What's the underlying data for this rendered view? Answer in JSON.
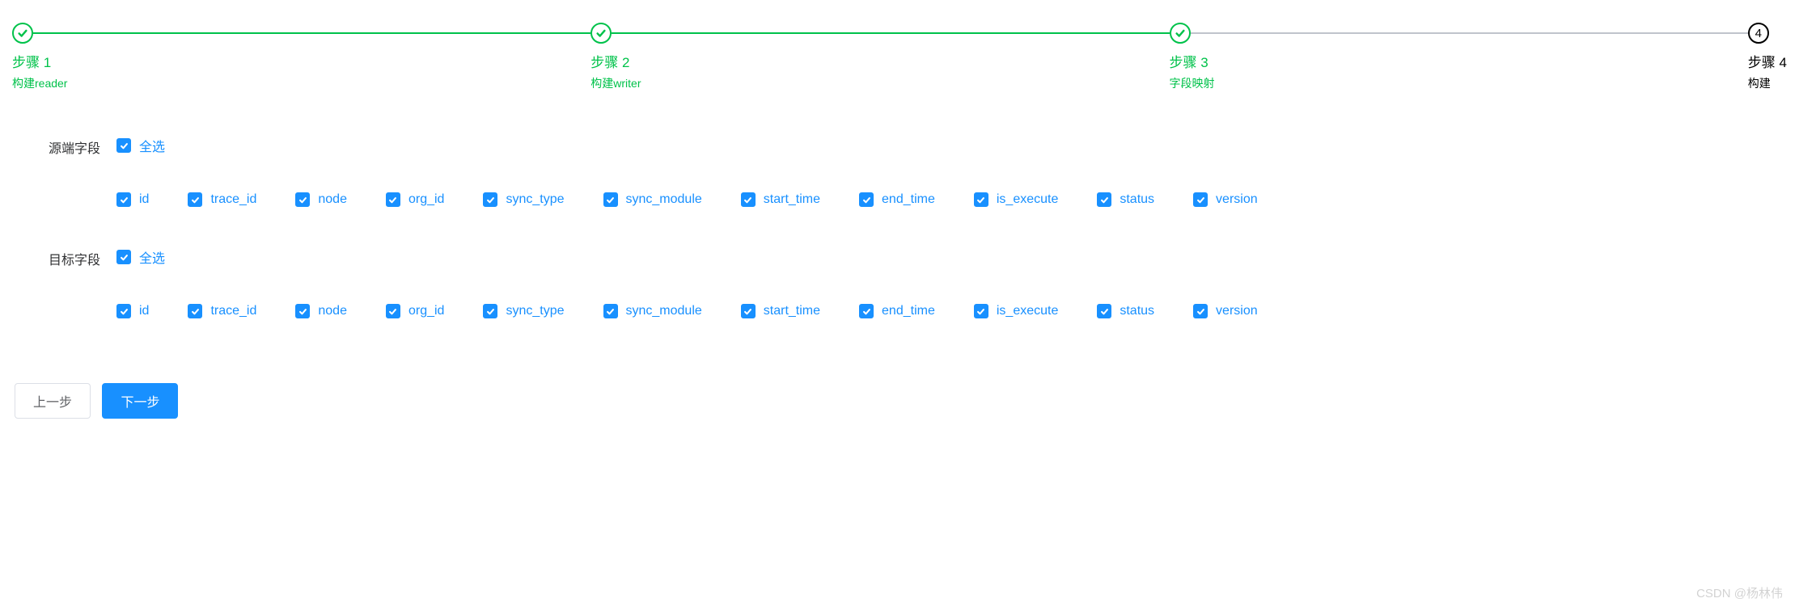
{
  "steps": [
    {
      "title": "步骤 1",
      "desc": "构建reader",
      "status": "done"
    },
    {
      "title": "步骤 2",
      "desc": "构建writer",
      "status": "done"
    },
    {
      "title": "步骤 3",
      "desc": "字段映射",
      "status": "done"
    },
    {
      "title": "步骤 4",
      "desc": "构建",
      "status": "wait",
      "number": "4"
    }
  ],
  "source": {
    "label": "源端字段",
    "selectAll": "全选",
    "fields": [
      "id",
      "trace_id",
      "node",
      "org_id",
      "sync_type",
      "sync_module",
      "start_time",
      "end_time",
      "is_execute",
      "status",
      "version"
    ]
  },
  "target": {
    "label": "目标字段",
    "selectAll": "全选",
    "fields": [
      "id",
      "trace_id",
      "node",
      "org_id",
      "sync_type",
      "sync_module",
      "start_time",
      "end_time",
      "is_execute",
      "status",
      "version"
    ]
  },
  "buttons": {
    "prev": "上一步",
    "next": "下一步"
  },
  "watermark": "CSDN @杨林伟"
}
